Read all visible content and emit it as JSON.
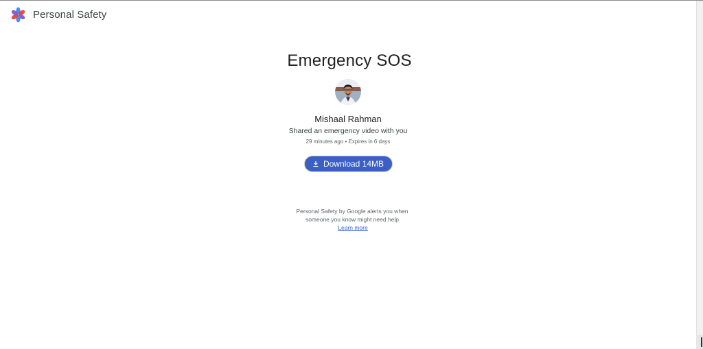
{
  "app": {
    "logo_icon": "personal-safety-flower-icon",
    "name": "Personal Safety"
  },
  "main": {
    "title": "Emergency SOS",
    "avatar_icon": "profile-photo",
    "sender_name": "Mishaal Rahman",
    "message": "Shared an emergency video with you",
    "meta": "29 minutes ago • Expires in 6 days",
    "download": {
      "icon": "download-icon",
      "label": "Download 14MB"
    }
  },
  "footer": {
    "line1": "Personal Safety by Google alerts you when",
    "line2": "someone you know might need help",
    "learn_more": "Learn more"
  },
  "colors": {
    "button": "#3b5fc4",
    "link": "#3367d6",
    "logo_blue": "#4285f4",
    "logo_red": "#ea4335",
    "logo_purple": "#7b5ccf"
  }
}
